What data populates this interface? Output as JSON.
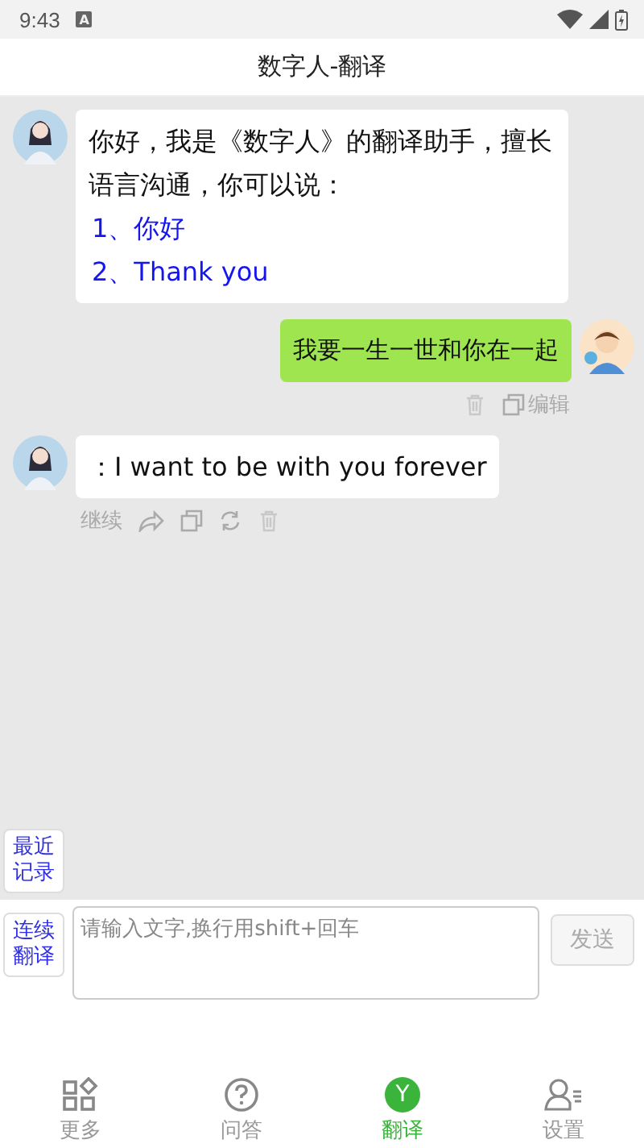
{
  "status_bar": {
    "time": "9:43",
    "notification": "A"
  },
  "header": {
    "title": "数字人-翻译"
  },
  "messages": [
    {
      "kind": "bot",
      "lines": [
        "你好，我是《数字人》的翻译助手，擅长语言沟通，你可以说："
      ],
      "suggestions": [
        "1、你好",
        "2、Thank you"
      ]
    },
    {
      "kind": "user",
      "lines": [
        "我要一生一世和你在一起"
      ],
      "actions": [
        {
          "kind": "delete"
        },
        {
          "kind": "copy",
          "label": "编辑"
        }
      ]
    },
    {
      "kind": "bot",
      "lines": [
        "：I want to be with you forever"
      ],
      "actions": [
        {
          "kind": "text",
          "label": "继续"
        },
        {
          "kind": "share"
        },
        {
          "kind": "copy"
        },
        {
          "kind": "refresh"
        },
        {
          "kind": "delete"
        }
      ]
    }
  ],
  "recent_button": "最近记录",
  "composer": {
    "mode_button": "连续翻译",
    "placeholder": "请输入文字,换行用shift+回车",
    "send": "发送",
    "send_disabled": true
  },
  "tabs": [
    {
      "kind": "grid",
      "label": "更多",
      "selected": false
    },
    {
      "kind": "help",
      "label": "问答",
      "selected": false
    },
    {
      "kind": "badge",
      "label": "翻译",
      "badge": "Y",
      "selected": true
    },
    {
      "kind": "user",
      "label": "设置",
      "selected": false
    }
  ]
}
